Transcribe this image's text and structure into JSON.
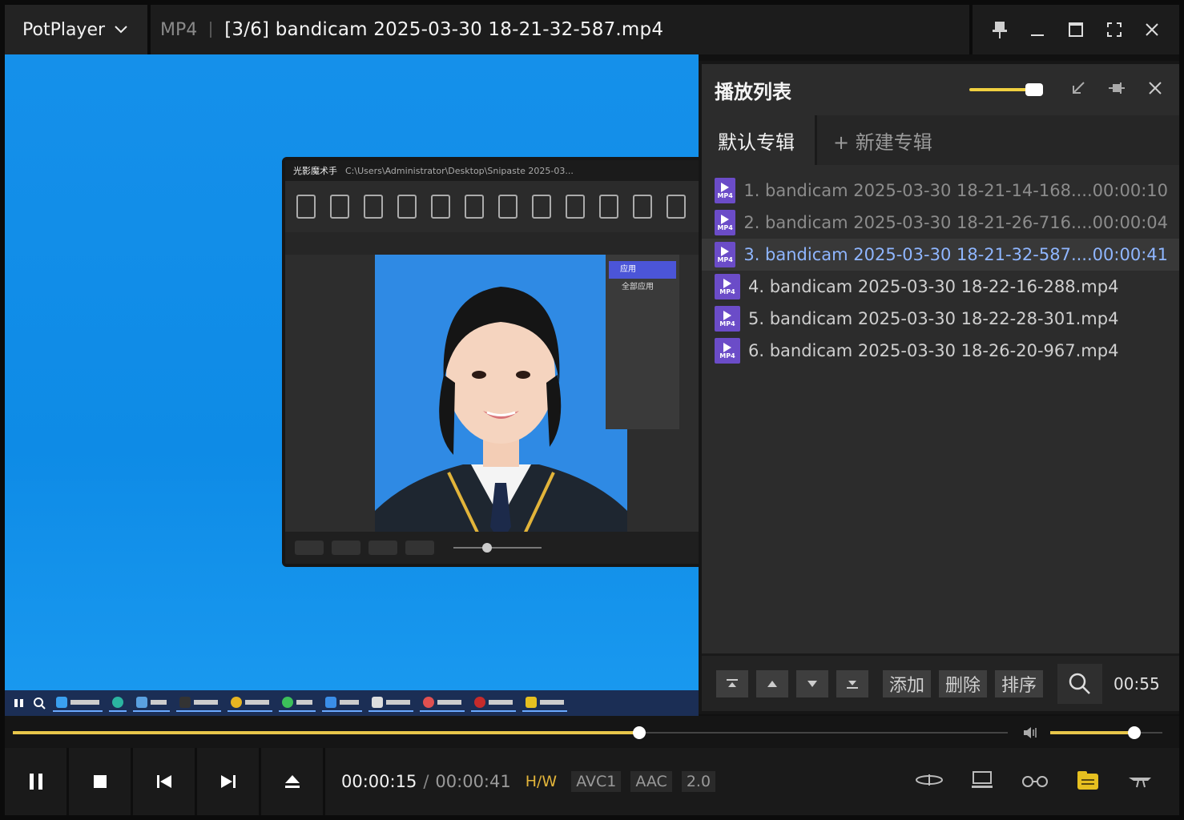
{
  "titlebar": {
    "app_name": "PotPlayer",
    "format": "MP4",
    "title": "[3/6] bandicam 2025-03-30 18-21-32-587.mp4"
  },
  "inner_window": {
    "app_title": "光影魔术手",
    "path": "C:\\Users\\Administrator\\Desktop\\Snipaste 2025-03...",
    "menu_item_1": "应用",
    "menu_item_2": "全部应用"
  },
  "playlist": {
    "title": "播放列表",
    "tab_default": "默认专辑",
    "tab_new": "+ 新建专辑",
    "items": [
      {
        "name": "1. bandicam 2025-03-30 18-21-14-168....",
        "duration": "00:00:10",
        "state": "played"
      },
      {
        "name": "2. bandicam 2025-03-30 18-21-26-716....",
        "duration": "00:00:04",
        "state": "played"
      },
      {
        "name": "3. bandicam 2025-03-30 18-21-32-587....",
        "duration": "00:00:41",
        "state": "current"
      },
      {
        "name": "4. bandicam 2025-03-30 18-22-16-288.mp4",
        "duration": "",
        "state": "normal"
      },
      {
        "name": "5. bandicam 2025-03-30 18-22-28-301.mp4",
        "duration": "",
        "state": "normal"
      },
      {
        "name": "6. bandicam 2025-03-30 18-26-20-967.mp4",
        "duration": "",
        "state": "normal"
      }
    ],
    "badge_label": "MP4",
    "btn_add": "添加",
    "btn_delete": "删除",
    "btn_sort": "排序",
    "total_time": "00:55"
  },
  "player": {
    "seek_progress": 0.63,
    "volume_level": 0.75,
    "current_time": "00:00:15",
    "separator": "/",
    "total_time": "00:00:41",
    "decoder": "H/W",
    "video_codec": "AVC1",
    "audio_codec": "AAC",
    "channels": "2.0"
  },
  "colors": {
    "accent": "#e8c64a",
    "current_item": "#8fb6ff",
    "badge": "#6b4cc8"
  }
}
